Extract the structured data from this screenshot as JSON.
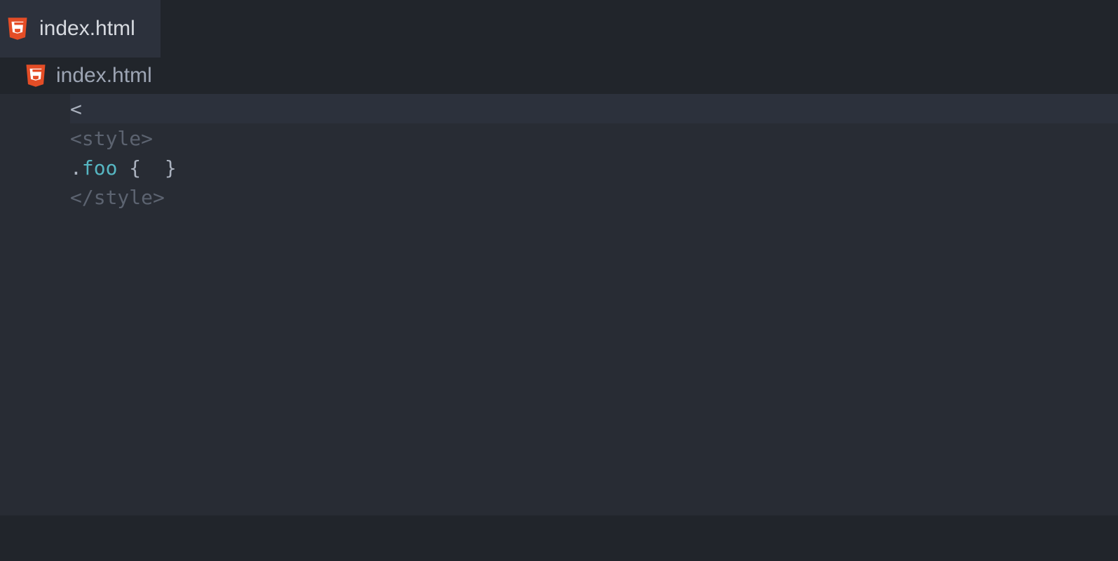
{
  "tab": {
    "label": "index.html"
  },
  "breadcrumb": {
    "label": "index.html"
  },
  "code": {
    "line1": {
      "text": "<"
    },
    "line2": {
      "open_bracket": "<",
      "tag": "style",
      "close_bracket": ">"
    },
    "line3": {
      "selector_dot": ".",
      "selector_name": "foo",
      "space1": " ",
      "open_brace": "{",
      "space2": "  ",
      "close_brace": "}"
    },
    "line4": {
      "open_bracket": "</",
      "tag": "style",
      "close_bracket": ">"
    }
  }
}
